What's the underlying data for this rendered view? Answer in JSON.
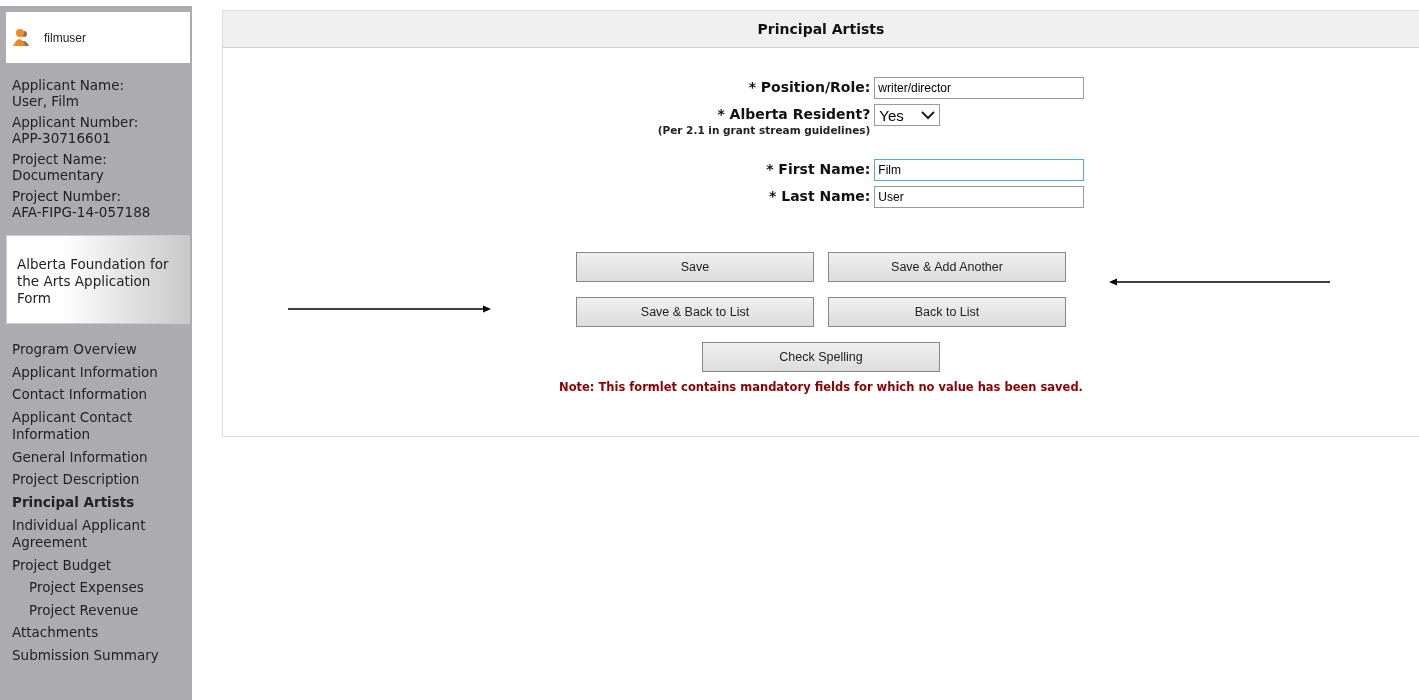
{
  "user": {
    "name": "filmuser"
  },
  "applicant_info": [
    {
      "label": "Applicant Name:",
      "value": "User, Film"
    },
    {
      "label": "Applicant Number:",
      "value": "APP-30716601"
    },
    {
      "label": "Project Name:",
      "value": "Documentary"
    },
    {
      "label": "Project Number:",
      "value": "AFA-FIPG-14-057188"
    }
  ],
  "form_title": "Alberta Foundation for the Arts Application Form",
  "nav": [
    {
      "label": "Program Overview",
      "selected": false
    },
    {
      "label": "Applicant Information",
      "selected": false
    },
    {
      "label": "Contact Information",
      "selected": false
    },
    {
      "label": "Applicant Contact Information",
      "selected": false
    },
    {
      "label": "General Information",
      "selected": false
    },
    {
      "label": "Project Description",
      "selected": false
    },
    {
      "label": "Principal Artists",
      "selected": true
    },
    {
      "label": "Individual Applicant Agreement",
      "selected": false
    },
    {
      "label": "Project Budget",
      "selected": false,
      "children": [
        {
          "label": "Project Expenses",
          "selected": false
        },
        {
          "label": "Project Revenue",
          "selected": false
        }
      ]
    },
    {
      "label": "Attachments",
      "selected": false
    },
    {
      "label": "Submission Summary",
      "selected": false
    }
  ],
  "panel": {
    "title": "Principal Artists",
    "fields": [
      {
        "kind": "text",
        "label": "* Position/Role:",
        "value": "writer/director",
        "focused": false
      },
      {
        "kind": "select",
        "label": "* Alberta Resident?",
        "note": "(Per 2.1 in grant stream guidelines)",
        "value": "Yes",
        "focused": false
      },
      {
        "kind": "text",
        "label": "* First Name:",
        "value": "Film",
        "focused": true
      },
      {
        "kind": "text",
        "label": "* Last Name:",
        "value": "User",
        "focused": false
      }
    ],
    "buttons": [
      "Save",
      "Save & Add Another",
      "Save & Back to List",
      "Back to List",
      "Check Spelling"
    ],
    "note": "Note: This formlet contains mandatory fields for which no value has been saved."
  }
}
